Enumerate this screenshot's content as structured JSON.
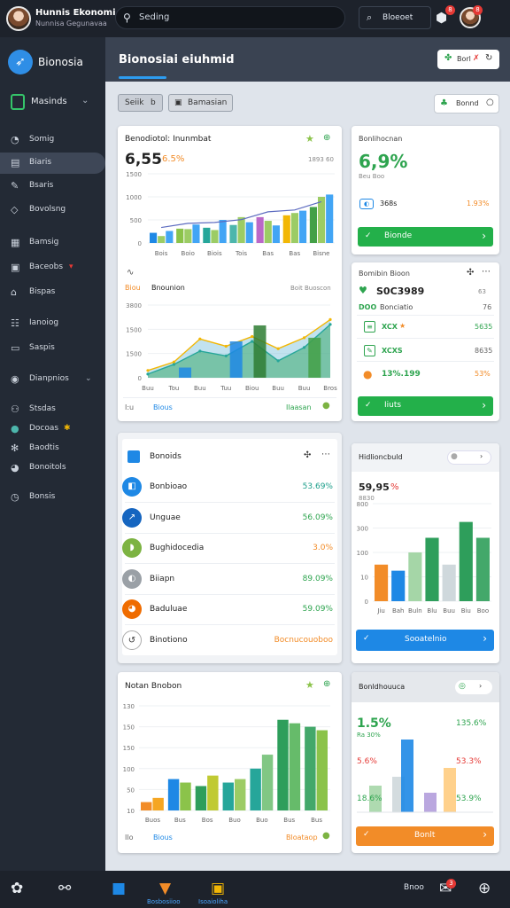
{
  "user": {
    "name": "Hunnis Ekonomi",
    "subtitle": "Nunnisa Gegunavaa"
  },
  "search": {
    "placeholder": "Seding"
  },
  "top_filter": {
    "label": "Bloeoet"
  },
  "notifications": {
    "count_a": "8",
    "count_b": "8"
  },
  "brand": {
    "name": "Bionosia"
  },
  "workspace": {
    "label": "Masinds"
  },
  "nav": [
    {
      "label": "Somig",
      "icon": "dashboard-icon"
    },
    {
      "label": "Biaris",
      "icon": "chart-icon"
    },
    {
      "label": "Bsaris",
      "icon": "edit-icon"
    },
    {
      "label": "Bovolsng",
      "icon": "tag-icon"
    },
    {
      "label": "Bamsig",
      "icon": "grid-icon"
    },
    {
      "label": "Baceobs",
      "icon": "table-icon"
    },
    {
      "label": "Bispas",
      "icon": "share-icon"
    },
    {
      "label": "Ianoiog",
      "icon": "users-icon"
    },
    {
      "label": "Saspis",
      "icon": "doc-icon"
    },
    {
      "label": "Dianpnios",
      "icon": "drop-icon"
    },
    {
      "label": "Stsdas",
      "icon": "people-icon"
    },
    {
      "label": "Docoas",
      "icon": "globe-icon"
    },
    {
      "label": "Baodtis",
      "icon": "gear-icon"
    },
    {
      "label": "Bonoitols",
      "icon": "pie-icon"
    },
    {
      "label": "Bonsis",
      "icon": "clock-icon"
    }
  ],
  "page": {
    "title": "Bionosiai eiuhmid",
    "header_button": "Borl"
  },
  "filters": {
    "pill1": "Seiik",
    "pill1_suffix": "b",
    "pill2": "Bamasian",
    "sort": "Bonnd"
  },
  "card1": {
    "title": "Benodiotol: Inunmbat",
    "value": "6,55",
    "value_suffix": "6.5%",
    "small": "1893 60",
    "y_ticks": [
      "1500",
      "1000",
      "500",
      "0"
    ],
    "x_ticks": [
      "Bois",
      "Boio",
      "Biois",
      "Tois",
      "Bas",
      "Bas",
      "Bisne"
    ],
    "mid_label": "Biou",
    "mid_title": "Bnounion",
    "mid_small": "Boit Buoscon",
    "y2_ticks": [
      "3800",
      "1500",
      "1500",
      "0"
    ],
    "x2_ticks": [
      "Buu",
      "Tou",
      "Buu",
      "Tuu",
      "Biou",
      "Buu",
      "Buu",
      "Bros"
    ],
    "foot_left": "I:u",
    "foot_link": "Bious",
    "foot_right": "Ilaasan",
    "colors": {
      "green": "#2ea44f",
      "blue": "#1e88e5",
      "orange": "#f28c28"
    }
  },
  "card2": {
    "title": "Bonlihocnan",
    "value": "6,9%",
    "small": "Beu Boo",
    "row_label": "368s",
    "row_val": "1.93%",
    "button": "Bionde"
  },
  "card3": {
    "title": "Bomibin Bioon",
    "main_value": "S0C3989",
    "rows": [
      {
        "label": "DOO",
        "extra": "Bonciatio",
        "val": "76"
      },
      {
        "label": "XCX",
        "val": "5635"
      },
      {
        "label": "XCXS",
        "val": "8635"
      },
      {
        "label": "13%.199",
        "val": "53%"
      }
    ],
    "button": "Iiuts"
  },
  "list_card": {
    "title": "Bonoids",
    "items": [
      {
        "label": "Bonbioao",
        "val": "53.69%",
        "color": "#1e88e5",
        "val_color": "#1b9e8a"
      },
      {
        "label": "Unguae",
        "val": "56.09%",
        "color": "#1565c0",
        "val_color": "#2ea44f"
      },
      {
        "label": "Bughidocedia",
        "val": "3.0%",
        "color": "#7cb342",
        "val_color": "#f28c28"
      },
      {
        "label": "Biiapn",
        "val": "89.09%",
        "color": "#9aa0a6",
        "val_color": "#2ea44f"
      },
      {
        "label": "Baduluae",
        "val": "59.09%",
        "color": "#ef6c00",
        "val_color": "#2ea44f"
      },
      {
        "label": "Binotiono",
        "val": "Bocnucouoboo",
        "color": "#ffffff",
        "val_color": "#f28c28"
      }
    ]
  },
  "bar_card": {
    "title": "Hidlioncbuld",
    "value": "59,95",
    "value_suffix": "%",
    "small": "8830",
    "y_ticks": [
      "800",
      "300",
      "100",
      "10",
      "0"
    ],
    "x_ticks": [
      "Jiu",
      "Bah",
      "Buln",
      "Blu",
      "Buu",
      "Biu",
      "Boo"
    ],
    "button": "Sooatelnio"
  },
  "bottom_left_card": {
    "title": "Notan Bnobon",
    "y_ticks": [
      "130",
      "150",
      "150",
      "100",
      "50",
      "10"
    ],
    "x_ticks": [
      "Buos",
      "Bus",
      "Bos",
      "Buo",
      "Buo",
      "Bus",
      "Bus"
    ],
    "foot_left": "Ilo",
    "foot_link": "Bious",
    "foot_right": "Bloataop"
  },
  "bottom_right_card": {
    "title": "Bonldhouuca",
    "value": "1.5%",
    "small": "Ra 30%",
    "v1": "135.6%",
    "v2": "5.6%",
    "v3": "53.3%",
    "v4": "18.6%",
    "v5": "53.9%",
    "button": "Bonlt"
  },
  "bottombar": {
    "label_a": "Bosbosiioo",
    "label_b": "Isoaioliha",
    "right_label": "Bnoo",
    "badge": "3"
  },
  "chart_data": [
    {
      "type": "bar",
      "categories": [
        "Bois",
        "Boio",
        "Biois",
        "Tois",
        "Bas",
        "Bas",
        "Bisne"
      ],
      "series": [
        {
          "values": [
            220,
            310,
            330,
            390,
            560,
            600,
            780
          ]
        },
        {
          "values": [
            150,
            300,
            280,
            560,
            480,
            650,
            1000
          ]
        },
        {
          "values": [
            260,
            400,
            500,
            450,
            380,
            700,
            1050
          ]
        }
      ],
      "ylim": [
        0,
        1500
      ]
    },
    {
      "type": "area",
      "x": [
        "Buu",
        "Tou",
        "Buu",
        "Tuu",
        "Biou",
        "Buu",
        "Buu",
        "Bros"
      ],
      "series": [
        {
          "values": [
            300,
            650,
            1600,
            1300,
            1700,
            1200,
            1650,
            2400
          ]
        },
        {
          "values": [
            150,
            550,
            1100,
            900,
            1500,
            700,
            1250,
            2200
          ]
        }
      ],
      "ylim": [
        0,
        3000
      ]
    },
    {
      "type": "bar",
      "categories": [
        "Jiu",
        "Bah",
        "Buln",
        "Blu",
        "Buu",
        "Biu",
        "Boo"
      ],
      "series": [
        {
          "values": [
            300,
            250,
            400,
            520,
            300,
            650,
            520
          ]
        }
      ],
      "ylim": [
        0,
        800
      ]
    },
    {
      "type": "bar",
      "categories": [
        "Buos",
        "Bus",
        "Bos",
        "Buo",
        "Buo",
        "Bus",
        "Bus"
      ],
      "series": [
        {
          "values": [
            12,
            45,
            35,
            40,
            60,
            130,
            120
          ]
        },
        {
          "values": [
            18,
            40,
            50,
            45,
            80,
            125,
            115
          ]
        }
      ],
      "ylim": [
        0,
        150
      ]
    }
  ]
}
